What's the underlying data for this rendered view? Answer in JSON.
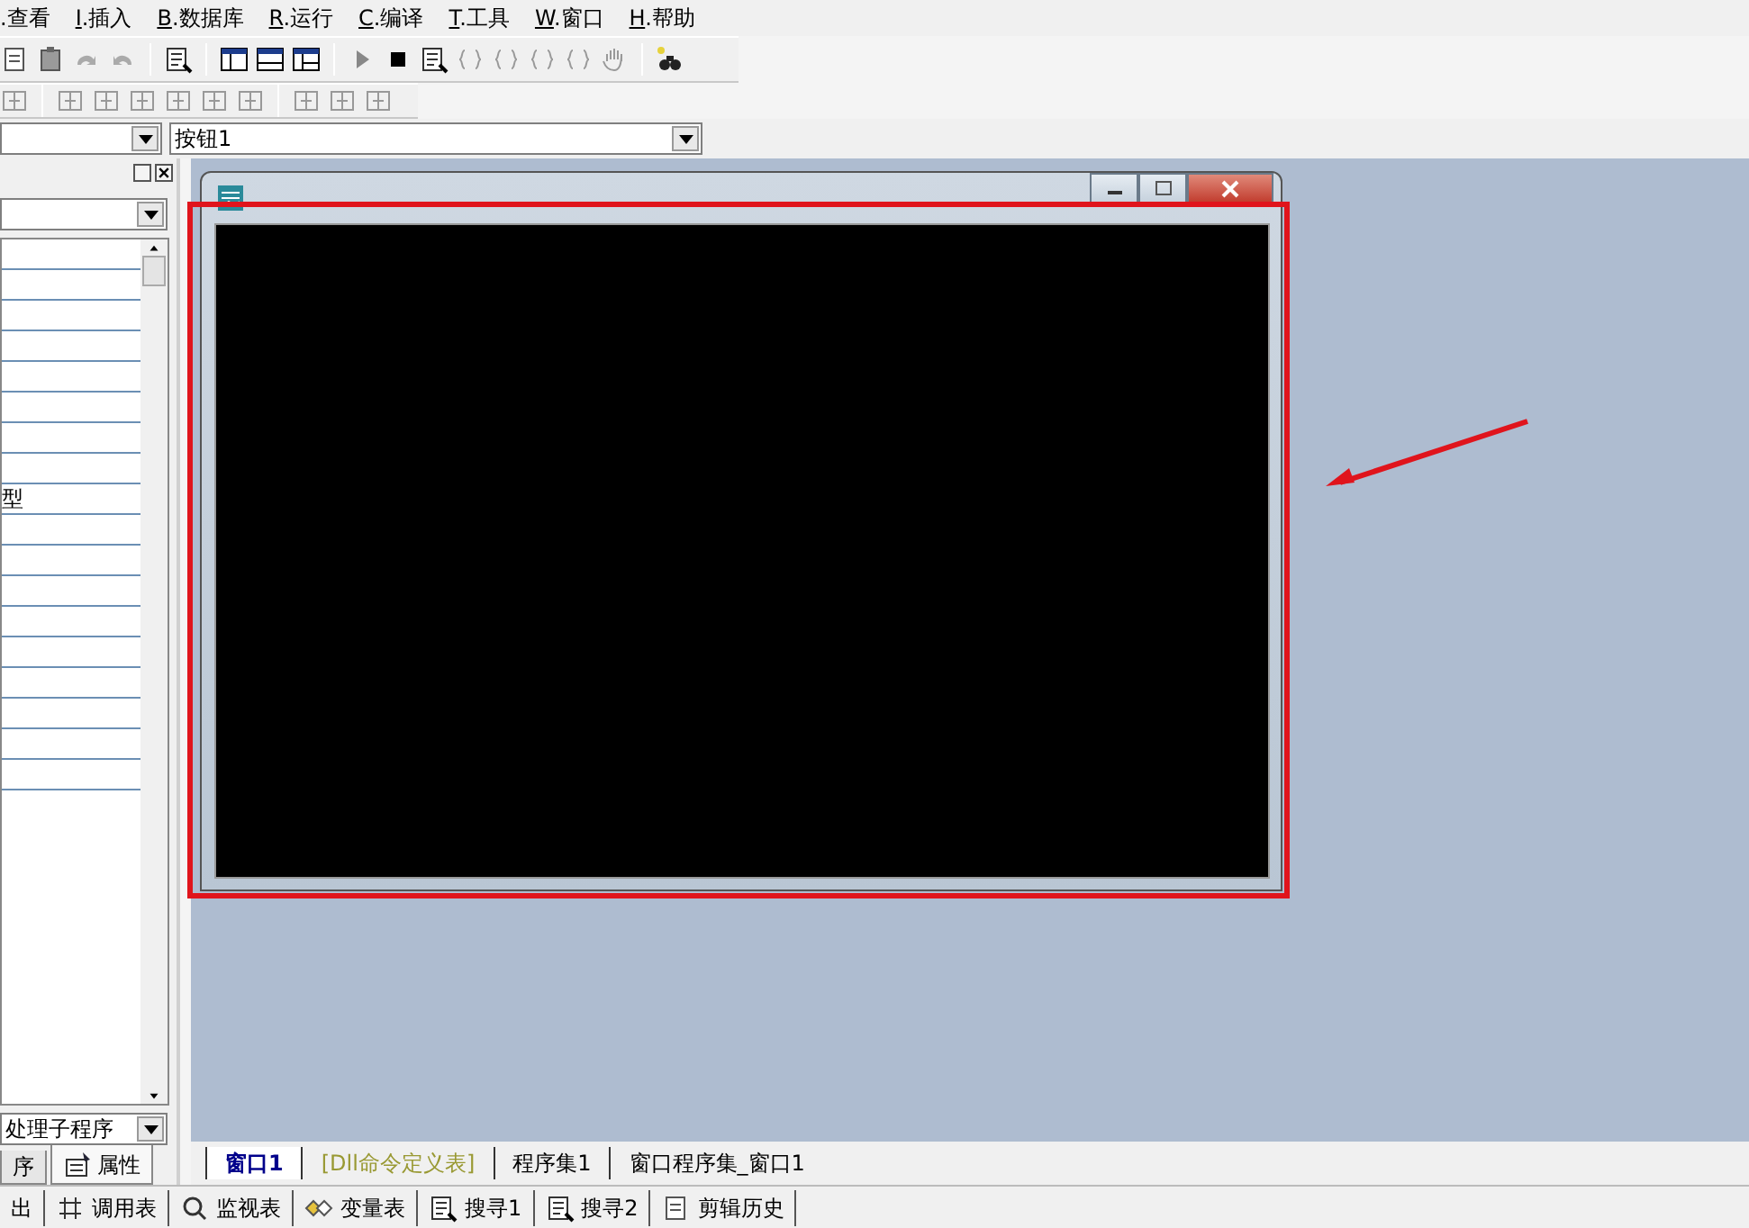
{
  "menu": [
    {
      "text": ".查看"
    },
    {
      "key": "I",
      "text": ".插入"
    },
    {
      "key": "B",
      "text": ".数据库"
    },
    {
      "key": "R",
      "text": ".运行"
    },
    {
      "key": "C",
      "text": ".编译"
    },
    {
      "key": "T",
      "text": ".工具"
    },
    {
      "key": "W",
      "text": ".窗口"
    },
    {
      "key": "H",
      "text": ".帮助"
    }
  ],
  "object_combo": {
    "value": "按钮1"
  },
  "property_list": {
    "cut_text": "型"
  },
  "event_combo": {
    "value": "处理子程序"
  },
  "panel_tabs": [
    {
      "label": "序",
      "selected": false
    },
    {
      "label": "属性",
      "selected": true
    }
  ],
  "doc_tabs": [
    {
      "label": "窗口1",
      "kind": "form",
      "selected": true
    },
    {
      "label": "[Dll命令定义表]",
      "kind": "dll",
      "selected": false
    },
    {
      "label": "程序集1",
      "kind": "code",
      "selected": false
    },
    {
      "label": "窗口程序集_窗口1",
      "kind": "code",
      "selected": false
    }
  ],
  "bottom_tabs": [
    {
      "label": "出"
    },
    {
      "label": "调用表"
    },
    {
      "label": "监视表"
    },
    {
      "label": "变量表"
    },
    {
      "label": "搜寻1"
    },
    {
      "label": "搜寻2"
    },
    {
      "label": "剪辑历史"
    }
  ]
}
